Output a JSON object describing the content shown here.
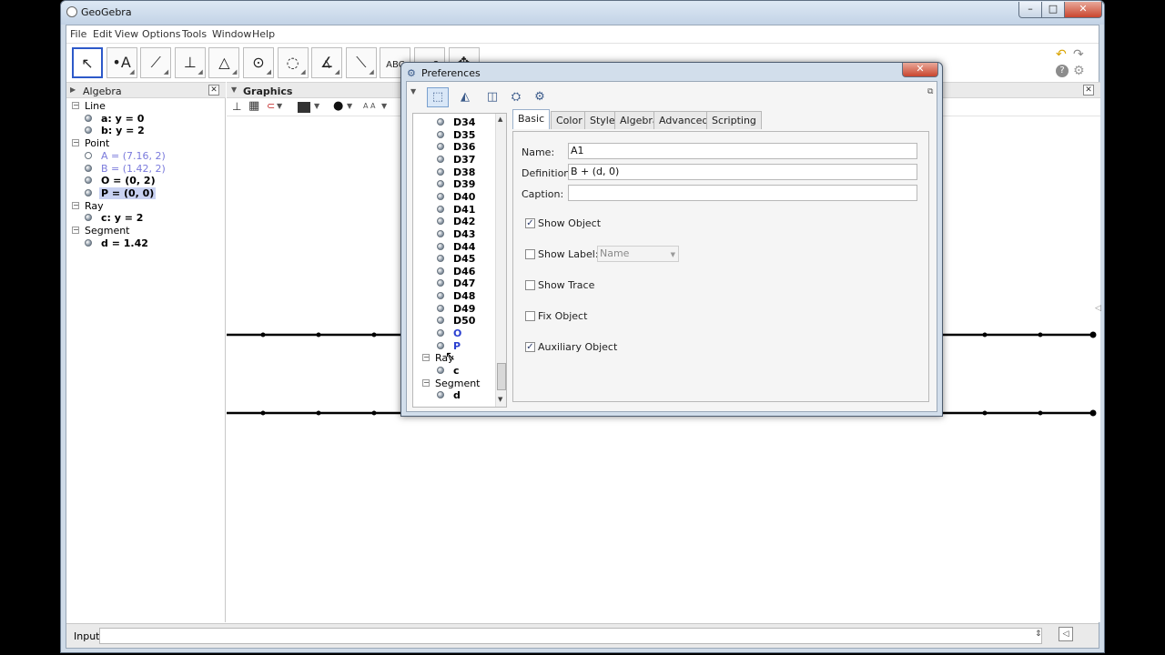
{
  "app": {
    "title": "GeoGebra"
  },
  "menu": [
    "File",
    "Edit",
    "View",
    "Options",
    "Tools",
    "Window",
    "Help"
  ],
  "tools": [
    {
      "icon": "move-tool-icon",
      "glyph": "↖"
    },
    {
      "icon": "point-tool-icon",
      "glyph": "•A"
    },
    {
      "icon": "line-tool-icon",
      "glyph": "⟋"
    },
    {
      "icon": "perpendicular-line-tool-icon",
      "glyph": "⊥"
    },
    {
      "icon": "polygon-tool-icon",
      "glyph": "△"
    },
    {
      "icon": "circle-tool-icon",
      "glyph": "⊙"
    },
    {
      "icon": "circle-through-points-tool-icon",
      "glyph": "◌"
    },
    {
      "icon": "angle-tool-icon",
      "glyph": "∡"
    },
    {
      "icon": "reflect-tool-icon",
      "glyph": "⟍"
    },
    {
      "icon": "text-tool-icon",
      "glyph": "ABC"
    },
    {
      "icon": "slider-tool-icon",
      "glyph": "a=2"
    },
    {
      "icon": "move-graphics-view-tool-icon",
      "glyph": "✥"
    }
  ],
  "algebra": {
    "title": "Algebra",
    "tree": [
      {
        "type": "group",
        "label": "Line"
      },
      {
        "type": "item",
        "label": "a: y = 0",
        "bold": true,
        "hollow": false
      },
      {
        "type": "item",
        "label": "b: y = 2",
        "bold": true,
        "hollow": false
      },
      {
        "type": "group",
        "label": "Point"
      },
      {
        "type": "item",
        "label": "A = (7.16, 2)",
        "color": "#7b7bdc",
        "hollow": true
      },
      {
        "type": "item",
        "label": "B = (1.42, 2)",
        "color": "#7b7bdc",
        "hollow": false
      },
      {
        "type": "item",
        "label": "O = (0, 2)",
        "bold": true,
        "hollow": false
      },
      {
        "type": "item",
        "label": "P = (0, 0)",
        "bold": true,
        "selected": true,
        "hollow": false
      },
      {
        "type": "group",
        "label": "Ray"
      },
      {
        "type": "item",
        "label": "c: y = 2",
        "bold": true,
        "hollow": false
      },
      {
        "type": "group",
        "label": "Segment"
      },
      {
        "type": "item",
        "label": "d = 1.42",
        "bold": true,
        "hollow": false
      }
    ]
  },
  "graphics": {
    "title": "Graphics"
  },
  "input": {
    "label": "Input:",
    "value": ""
  },
  "preferences": {
    "title": "Preferences",
    "tree": {
      "items": [
        "D34",
        "D35",
        "D36",
        "D37",
        "D38",
        "D39",
        "D40",
        "D41",
        "D42",
        "D43",
        "D44",
        "D45",
        "D46",
        "D47",
        "D48",
        "D49",
        "D50",
        "O",
        "P"
      ],
      "ray_group": "Ray",
      "ray_item": "c",
      "segment_group": "Segment",
      "segment_item": "d"
    },
    "tabs": [
      "Basic",
      "Color",
      "Style",
      "Algebra",
      "Advanced",
      "Scripting"
    ],
    "basic": {
      "name_label": "Name:",
      "name_value": "A1",
      "definition_label": "Definition:",
      "definition_value": "B + (d, 0)",
      "caption_label": "Caption:",
      "caption_value": "",
      "show_object": "Show Object",
      "show_label": "Show Label:",
      "label_mode": "Name",
      "show_trace": "Show Trace",
      "fix_object": "Fix Object",
      "auxiliary_object": "Auxiliary Object",
      "checked": {
        "show_object": true,
        "show_label": false,
        "show_trace": false,
        "fix_object": false,
        "auxiliary_object": true
      }
    }
  }
}
